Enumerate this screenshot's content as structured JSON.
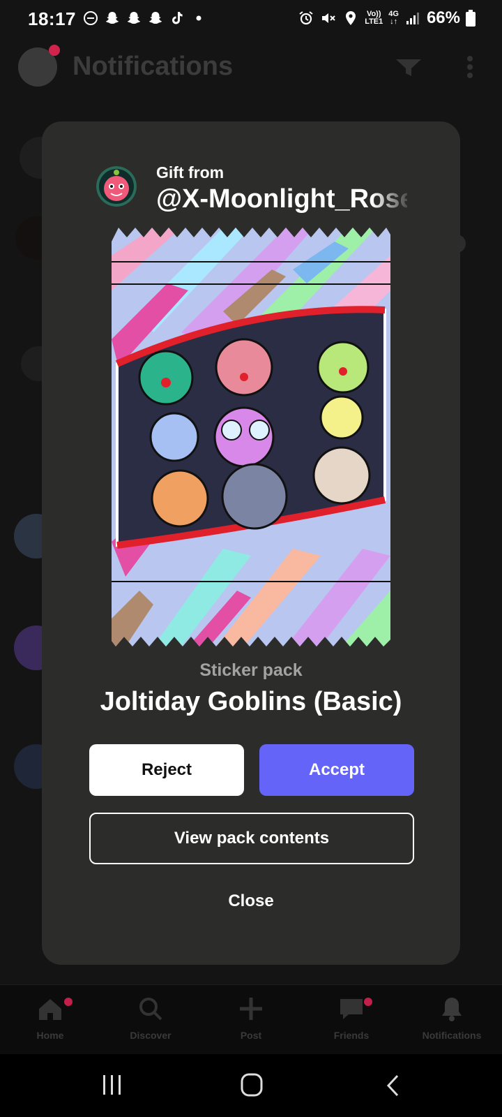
{
  "status_bar": {
    "time": "18:17",
    "network_top": "Vo))",
    "network_bottom": "LTE1",
    "signal_type": "4G",
    "battery": "66%"
  },
  "background_app": {
    "title": "Notifications",
    "nav": [
      {
        "label": "Home",
        "icon": "home-icon"
      },
      {
        "label": "Discover",
        "icon": "search-icon"
      },
      {
        "label": "Post",
        "icon": "plus-icon"
      },
      {
        "label": "Friends",
        "icon": "chat-icon"
      },
      {
        "label": "Notifications",
        "icon": "bell-icon"
      }
    ]
  },
  "gift_dialog": {
    "gift_label": "Gift from",
    "sender": "@X-Moonlight_Rose",
    "pack_type": "Sticker pack",
    "pack_name": "Joltiday Goblins (Basic)",
    "reject_label": "Reject",
    "accept_label": "Accept",
    "view_label": "View pack contents",
    "close_label": "Close"
  },
  "colors": {
    "accent": "#6464f8",
    "dialog_bg": "#2c2c2a",
    "notification_dot": "#c2204a"
  }
}
